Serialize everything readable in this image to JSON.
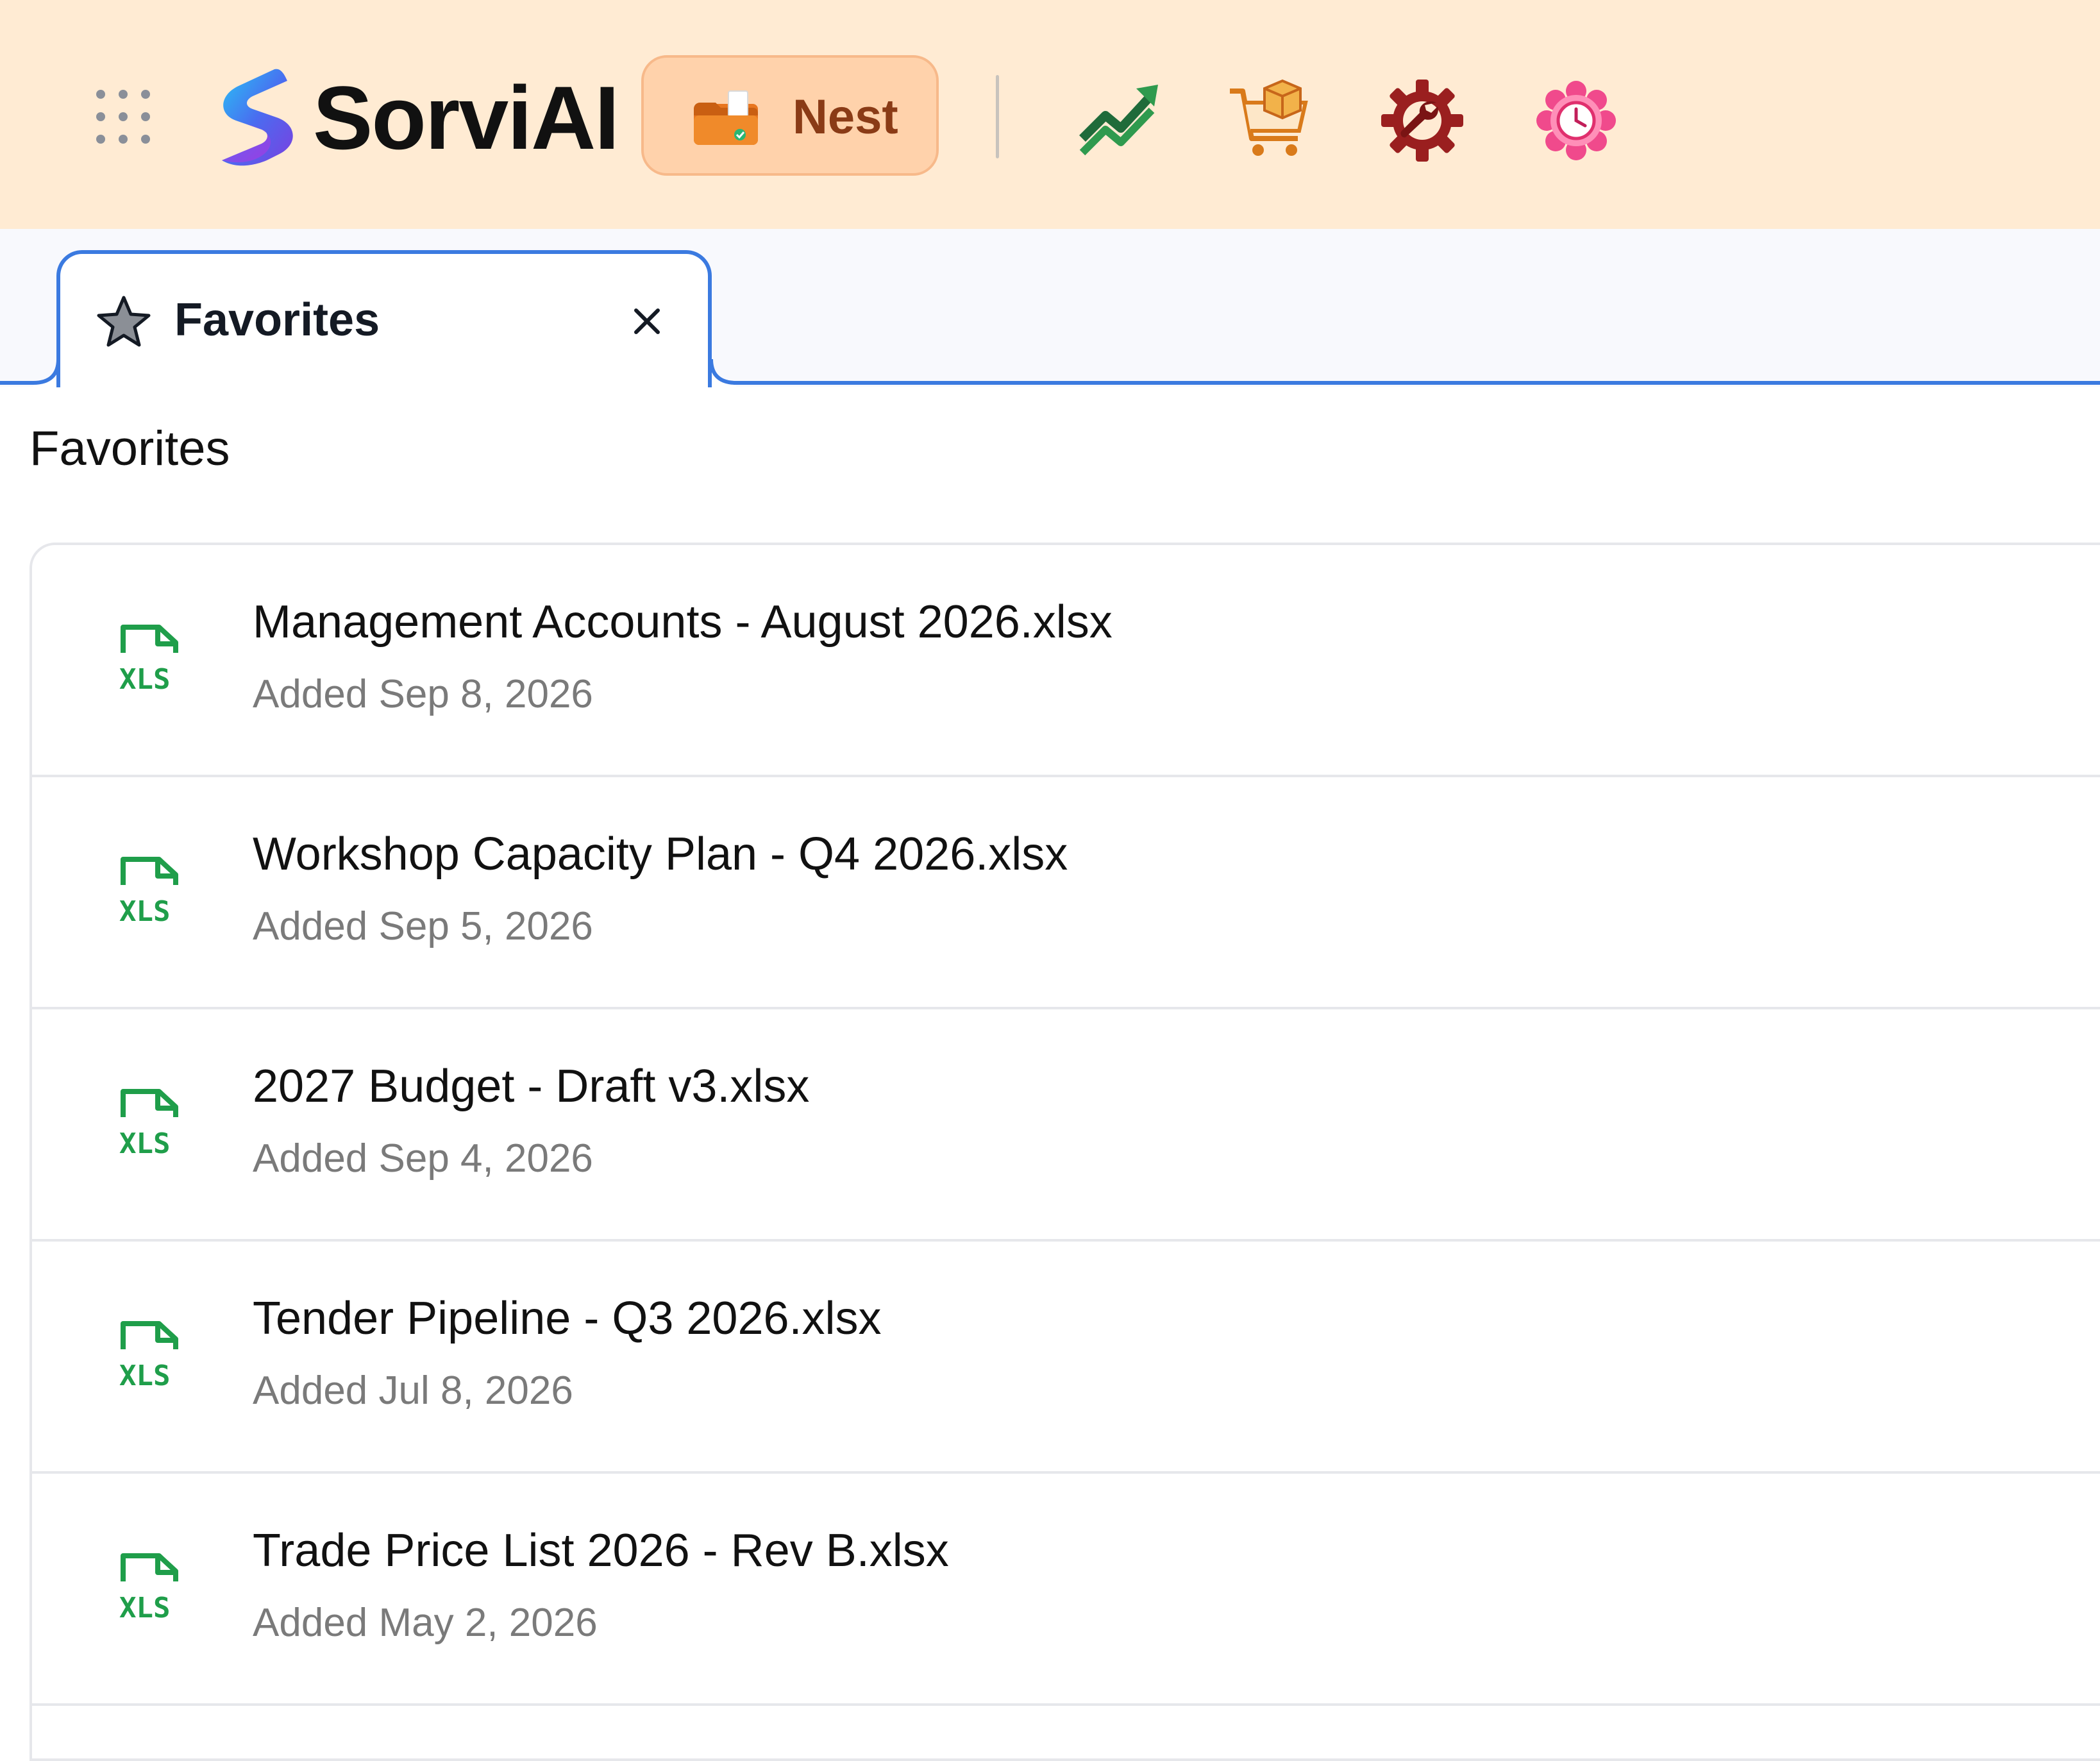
{
  "header": {
    "brand": "SorviAI",
    "workspace_button": "Nest",
    "app_icons": [
      "growth-chart-icon",
      "cart-box-icon",
      "gear-wrench-icon",
      "clock-flower-icon"
    ]
  },
  "tab": {
    "label": "Favorites"
  },
  "page": {
    "title": "Favorites"
  },
  "files": [
    {
      "name": "Management Accounts - August 2026.xlsx",
      "added": "Added Sep 8, 2026",
      "type": "XLS"
    },
    {
      "name": "Workshop Capacity Plan - Q4 2026.xlsx",
      "added": "Added Sep 5, 2026",
      "type": "XLS"
    },
    {
      "name": "2027 Budget - Draft v3.xlsx",
      "added": "Added Sep 4, 2026",
      "type": "XLS"
    },
    {
      "name": "Tender Pipeline - Q3 2026.xlsx",
      "added": "Added Jul 8, 2026",
      "type": "XLS"
    },
    {
      "name": "Trade Price List 2026 - Rev B.xlsx",
      "added": "Added May 2, 2026",
      "type": "XLS"
    }
  ],
  "colors": {
    "topbar_bg": "#ffebd3",
    "nest_bg": "#ffd2ab",
    "nest_text": "#8a3b16",
    "tab_accent": "#3b7ae0",
    "xls_green": "#1f9e4a",
    "date_gray": "#7a7a7a"
  }
}
